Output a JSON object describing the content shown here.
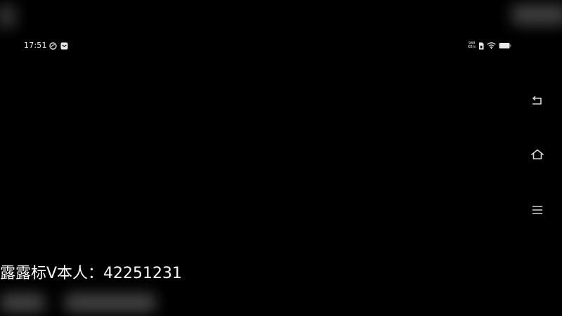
{
  "status_bar": {
    "time": "17:51",
    "net_speed_value": "988",
    "net_speed_unit": "KB/s",
    "notification_icons": [
      "swirl-app-icon",
      "mail-app-icon"
    ],
    "system_icons": [
      "sim-icon",
      "wifi-icon",
      "battery-icon"
    ]
  },
  "navigation": {
    "buttons": [
      "back-icon",
      "home-icon",
      "menu-icon"
    ]
  },
  "caption": {
    "text": "露露标V本人：42251231"
  },
  "colors": {
    "background": "#000000",
    "foreground": "#ffffff",
    "icon": "#d8d8d8"
  }
}
